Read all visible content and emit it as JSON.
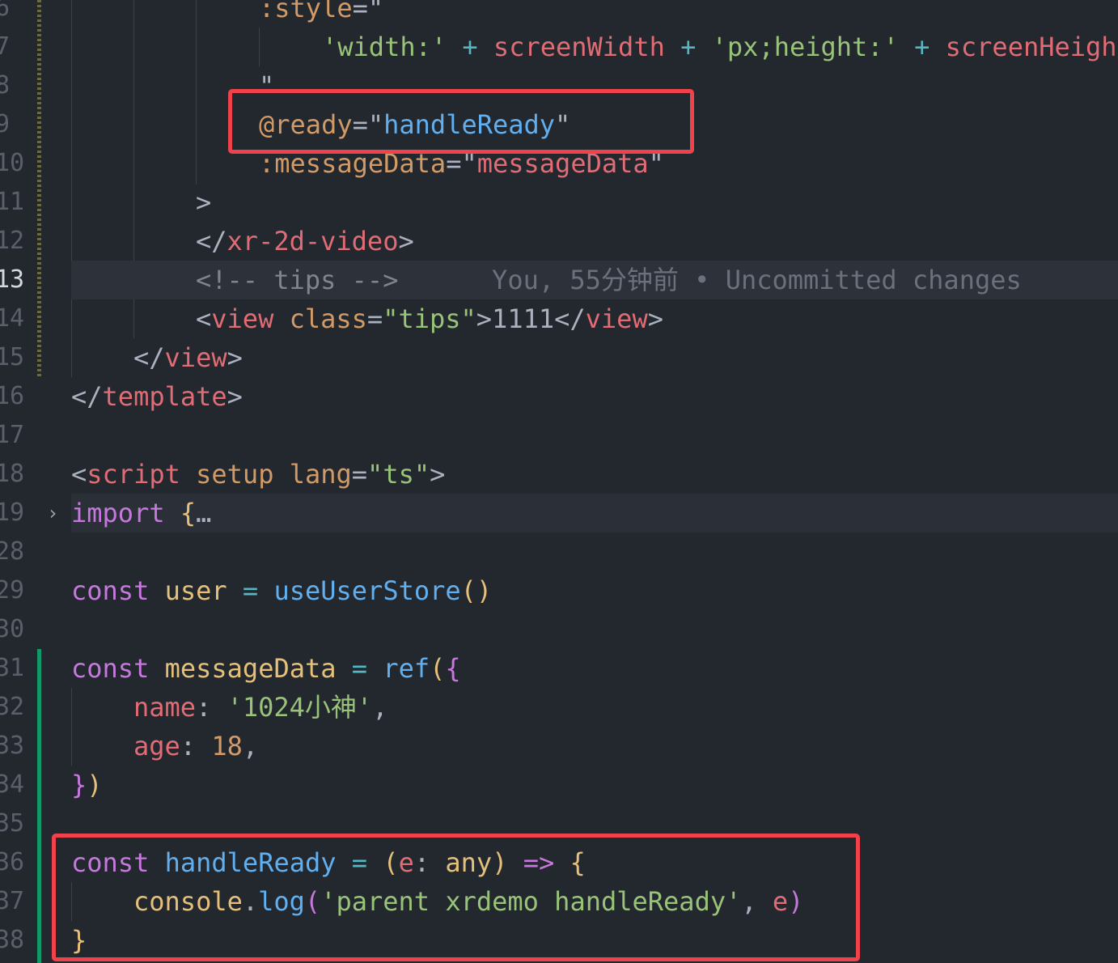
{
  "editor": {
    "lines": [
      {
        "number": "6",
        "tokens": [
          {
            "t": ":style",
            "c": "t-attr"
          },
          {
            "t": "=\"",
            "c": "t-punct"
          }
        ]
      },
      {
        "number": "7",
        "tokens": [
          {
            "t": "'width:'",
            "c": "t-str"
          },
          {
            "t": " ",
            "c": "t-plain"
          },
          {
            "t": "+",
            "c": "t-op"
          },
          {
            "t": " ",
            "c": "t-plain"
          },
          {
            "t": "screenWidth",
            "c": "t-prop"
          },
          {
            "t": " ",
            "c": "t-plain"
          },
          {
            "t": "+",
            "c": "t-op"
          },
          {
            "t": " ",
            "c": "t-plain"
          },
          {
            "t": "'px;height:'",
            "c": "t-str"
          },
          {
            "t": " ",
            "c": "t-plain"
          },
          {
            "t": "+",
            "c": "t-op"
          },
          {
            "t": " ",
            "c": "t-plain"
          },
          {
            "t": "screenHeight",
            "c": "t-prop"
          }
        ]
      },
      {
        "number": "8",
        "tokens": [
          {
            "t": "\"",
            "c": "t-punct"
          }
        ]
      },
      {
        "number": "9",
        "tokens": [
          {
            "t": "@ready",
            "c": "t-attr"
          },
          {
            "t": "=\"",
            "c": "t-punct"
          },
          {
            "t": "handleReady",
            "c": "t-fn"
          },
          {
            "t": "\"",
            "c": "t-punct"
          }
        ]
      },
      {
        "number": "10",
        "tokens": [
          {
            "t": ":messageData",
            "c": "t-attr"
          },
          {
            "t": "=\"",
            "c": "t-punct"
          },
          {
            "t": "messageData",
            "c": "t-prop"
          },
          {
            "t": "\"",
            "c": "t-punct"
          }
        ]
      },
      {
        "number": "11",
        "tokens": [
          {
            "t": ">",
            "c": "t-punct"
          }
        ]
      },
      {
        "number": "12",
        "tokens": [
          {
            "t": "</",
            "c": "t-punct"
          },
          {
            "t": "xr-2d-video",
            "c": "t-tag"
          },
          {
            "t": ">",
            "c": "t-punct"
          }
        ]
      },
      {
        "number": "13",
        "tokens": [
          {
            "t": "<!-- tips -->",
            "c": "t-cmt"
          },
          {
            "t": "      You, 55分钟前 • Uncommitted changes",
            "c": "t-ghost"
          }
        ]
      },
      {
        "number": "14",
        "tokens": [
          {
            "t": "<",
            "c": "t-punct"
          },
          {
            "t": "view",
            "c": "t-tag"
          },
          {
            "t": " ",
            "c": "t-plain"
          },
          {
            "t": "class",
            "c": "t-attr"
          },
          {
            "t": "=",
            "c": "t-punct"
          },
          {
            "t": "\"tips\"",
            "c": "t-str"
          },
          {
            "t": ">",
            "c": "t-punct"
          },
          {
            "t": "1111",
            "c": "t-plain"
          },
          {
            "t": "</",
            "c": "t-punct"
          },
          {
            "t": "view",
            "c": "t-tag"
          },
          {
            "t": ">",
            "c": "t-punct"
          }
        ]
      },
      {
        "number": "15",
        "tokens": [
          {
            "t": "</",
            "c": "t-punct"
          },
          {
            "t": "view",
            "c": "t-tag"
          },
          {
            "t": ">",
            "c": "t-punct"
          }
        ]
      },
      {
        "number": "16",
        "tokens": [
          {
            "t": "</",
            "c": "t-punct"
          },
          {
            "t": "template",
            "c": "t-tag"
          },
          {
            "t": ">",
            "c": "t-punct"
          }
        ]
      },
      {
        "number": "17",
        "tokens": []
      },
      {
        "number": "18",
        "tokens": [
          {
            "t": "<",
            "c": "t-punct"
          },
          {
            "t": "script",
            "c": "t-tag"
          },
          {
            "t": " ",
            "c": "t-plain"
          },
          {
            "t": "setup",
            "c": "t-attr"
          },
          {
            "t": " ",
            "c": "t-plain"
          },
          {
            "t": "lang",
            "c": "t-attr"
          },
          {
            "t": "=",
            "c": "t-punct"
          },
          {
            "t": "\"ts\"",
            "c": "t-str"
          },
          {
            "t": ">",
            "c": "t-punct"
          }
        ]
      },
      {
        "number": "19",
        "fold_marker": "›",
        "tokens": [
          {
            "t": "import",
            "c": "t-kw"
          },
          {
            "t": " ",
            "c": "t-plain"
          },
          {
            "t": "{",
            "c": "t-var"
          },
          {
            "t": "…",
            "c": "t-plain"
          }
        ]
      },
      {
        "number": "28",
        "tokens": []
      },
      {
        "number": "29",
        "tokens": [
          {
            "t": "const",
            "c": "t-kw"
          },
          {
            "t": " ",
            "c": "t-plain"
          },
          {
            "t": "user",
            "c": "t-var"
          },
          {
            "t": " ",
            "c": "t-plain"
          },
          {
            "t": "=",
            "c": "t-op"
          },
          {
            "t": " ",
            "c": "t-plain"
          },
          {
            "t": "useUserStore",
            "c": "t-fn"
          },
          {
            "t": "()",
            "c": "t-var"
          }
        ]
      },
      {
        "number": "30",
        "tokens": []
      },
      {
        "number": "31",
        "tokens": [
          {
            "t": "const",
            "c": "t-kw"
          },
          {
            "t": " ",
            "c": "t-plain"
          },
          {
            "t": "messageData",
            "c": "t-var"
          },
          {
            "t": " ",
            "c": "t-plain"
          },
          {
            "t": "=",
            "c": "t-op"
          },
          {
            "t": " ",
            "c": "t-plain"
          },
          {
            "t": "ref",
            "c": "t-fn"
          },
          {
            "t": "(",
            "c": "t-var"
          },
          {
            "t": "{",
            "c": "t-kw"
          }
        ]
      },
      {
        "number": "32",
        "tokens": [
          {
            "t": "name",
            "c": "t-prop"
          },
          {
            "t": ": ",
            "c": "t-plain"
          },
          {
            "t": "'1024小神'",
            "c": "t-str"
          },
          {
            "t": ",",
            "c": "t-plain"
          }
        ]
      },
      {
        "number": "33",
        "tokens": [
          {
            "t": "age",
            "c": "t-prop"
          },
          {
            "t": ": ",
            "c": "t-plain"
          },
          {
            "t": "18",
            "c": "t-num"
          },
          {
            "t": ",",
            "c": "t-plain"
          }
        ]
      },
      {
        "number": "34",
        "tokens": [
          {
            "t": "}",
            "c": "t-kw"
          },
          {
            "t": ")",
            "c": "t-var"
          }
        ]
      },
      {
        "number": "35",
        "tokens": []
      },
      {
        "number": "36",
        "tokens": [
          {
            "t": "const",
            "c": "t-kw"
          },
          {
            "t": " ",
            "c": "t-plain"
          },
          {
            "t": "handleReady",
            "c": "t-fn"
          },
          {
            "t": " ",
            "c": "t-plain"
          },
          {
            "t": "=",
            "c": "t-op"
          },
          {
            "t": " ",
            "c": "t-plain"
          },
          {
            "t": "(",
            "c": "t-var"
          },
          {
            "t": "e",
            "c": "t-param"
          },
          {
            "t": ": ",
            "c": "t-plain"
          },
          {
            "t": "any",
            "c": "t-var"
          },
          {
            "t": ")",
            "c": "t-var"
          },
          {
            "t": " ",
            "c": "t-plain"
          },
          {
            "t": "=>",
            "c": "t-kw"
          },
          {
            "t": " ",
            "c": "t-plain"
          },
          {
            "t": "{",
            "c": "t-var"
          }
        ]
      },
      {
        "number": "37",
        "tokens": [
          {
            "t": "console",
            "c": "t-var"
          },
          {
            "t": ".",
            "c": "t-plain"
          },
          {
            "t": "log",
            "c": "t-fn"
          },
          {
            "t": "(",
            "c": "t-kw"
          },
          {
            "t": "'parent xrdemo handleReady'",
            "c": "t-str"
          },
          {
            "t": ", ",
            "c": "t-plain"
          },
          {
            "t": "e",
            "c": "t-param"
          },
          {
            "t": ")",
            "c": "t-kw"
          }
        ]
      },
      {
        "number": "38",
        "tokens": [
          {
            "t": "}",
            "c": "t-var"
          }
        ]
      }
    ],
    "active_line": "13",
    "colors": {
      "background": "#23272e",
      "highlight_box": "#f0424a",
      "git_added": "#109868"
    }
  }
}
